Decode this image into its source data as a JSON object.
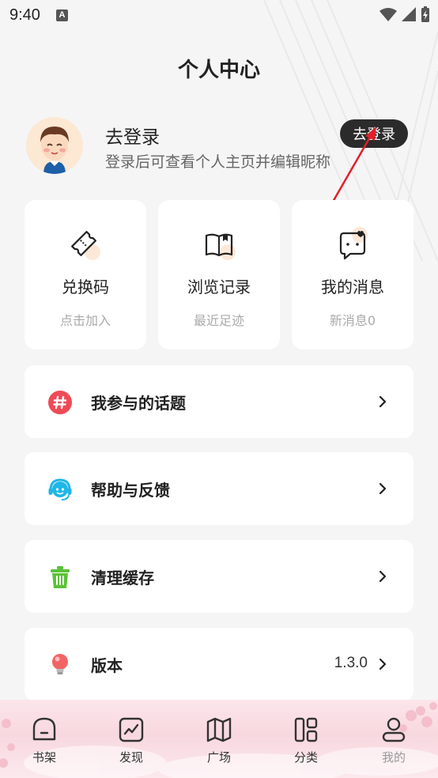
{
  "status_bar": {
    "time": "9:40",
    "notification_badge": "A"
  },
  "page_title": "个人中心",
  "profile": {
    "name": "去登录",
    "description": "登录后可查看个人主页并编辑昵称",
    "login_button": "去登录"
  },
  "cards": [
    {
      "title": "兑换码",
      "subtitle": "点击加入",
      "icon": "ticket-icon"
    },
    {
      "title": "浏览记录",
      "subtitle": "最近足迹",
      "icon": "book-icon"
    },
    {
      "title": "我的消息",
      "subtitle": "新消息0",
      "icon": "message-heart-icon"
    }
  ],
  "menu": [
    {
      "label": "我参与的话题",
      "icon": "hashtag-icon",
      "value": ""
    },
    {
      "label": "帮助与反馈",
      "icon": "headset-icon",
      "value": ""
    },
    {
      "label": "清理缓存",
      "icon": "trash-icon",
      "value": ""
    },
    {
      "label": "版本",
      "icon": "bulb-icon",
      "value": "1.3.0"
    }
  ],
  "tabbar": [
    {
      "label": "书架",
      "icon": "bookshelf-icon",
      "active": false
    },
    {
      "label": "发现",
      "icon": "discover-chart-icon",
      "active": false
    },
    {
      "label": "广场",
      "icon": "map-icon",
      "active": false
    },
    {
      "label": "分类",
      "icon": "category-icon",
      "active": false
    },
    {
      "label": "我的",
      "icon": "profile-icon",
      "active": true
    }
  ],
  "colors": {
    "accent_dark": "#2b2b2b",
    "hashtag": "#ef4b57",
    "headset": "#1fb6e8",
    "trash": "#5bc237",
    "bulb": "#f26464",
    "arrow": "#e0202a"
  }
}
